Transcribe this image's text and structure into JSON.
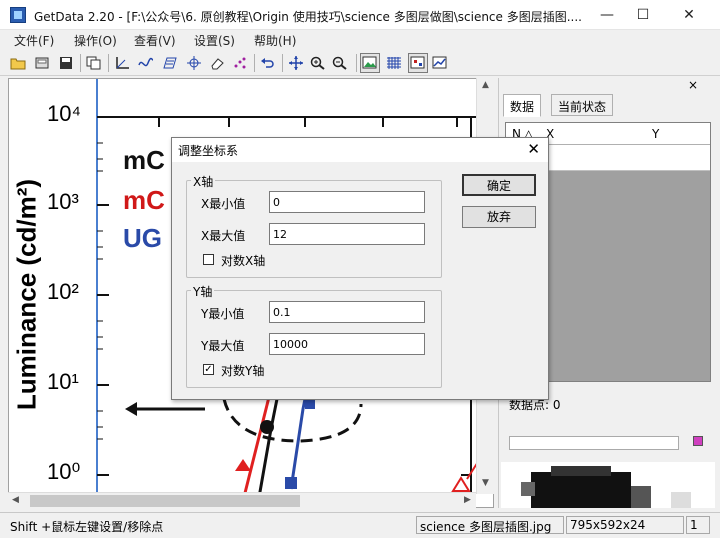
{
  "window": {
    "title": "GetData 2.20 - [F:\\公众号\\6. 原创教程\\Origin 使用技巧\\science 多图层做图\\science 多图层插图....",
    "minimize": "—",
    "maximize": "☐",
    "close": "✕"
  },
  "menu": {
    "items": [
      "文件(F)",
      "操作(O)",
      "查看(V)",
      "设置(S)",
      "帮助(H)"
    ]
  },
  "canvas": {
    "y_axis_label": "Luminance (cd/m²)",
    "y_ticks": [
      "10⁴",
      "10³",
      "10²",
      "10¹",
      "10⁰"
    ],
    "legend": [
      {
        "text": "mC",
        "color": "#111111"
      },
      {
        "text": "mC",
        "color": "#d01818"
      },
      {
        "text": "UG",
        "color": "#2a4aa8"
      }
    ],
    "series_colors": {
      "black": "#111111",
      "red": "#e02020",
      "blue": "#2a4aa8"
    }
  },
  "right_panel": {
    "close": "×",
    "tabs": [
      "数据",
      "当前状态"
    ],
    "columns": [
      "N",
      "X",
      "Y"
    ],
    "points_label": "数据点: 0"
  },
  "status": {
    "hint": "Shift +鼠标左键设置/移除点",
    "filename": "science 多图层插图.jpg",
    "dimensions": "795x592x24",
    "page": "1"
  },
  "dialog": {
    "title": "调整坐标系",
    "close": "✕",
    "x_group": "X轴",
    "x_min_label": "X最小值",
    "x_min_value": "0",
    "x_max_label": "X最大值",
    "x_max_value": "12",
    "x_log_label": "对数X轴",
    "x_log_checked": false,
    "y_group": "Y轴",
    "y_min_label": "Y最小值",
    "y_min_value": "0.1",
    "y_max_label": "Y最大值",
    "y_max_value": "10000",
    "y_log_label": "对数Y轴",
    "y_log_checked": true,
    "ok_label": "确定",
    "cancel_label": "放弃"
  }
}
